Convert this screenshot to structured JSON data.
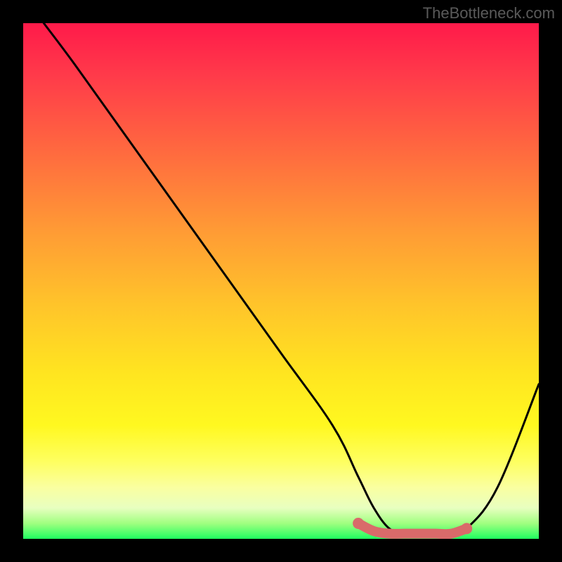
{
  "watermark": "TheBottleneck.com",
  "chart_data": {
    "type": "line",
    "title": "",
    "xlabel": "",
    "ylabel": "",
    "xlim": [
      0,
      100
    ],
    "ylim": [
      0,
      100
    ],
    "series": [
      {
        "name": "bottleneck-curve",
        "color": "#000000",
        "x": [
          4,
          10,
          20,
          30,
          40,
          50,
          60,
          65,
          68,
          71,
          74,
          77,
          80,
          83,
          86,
          92,
          100
        ],
        "y": [
          100,
          92,
          78,
          64,
          50,
          36,
          22,
          12,
          6,
          2,
          1,
          1,
          1,
          1,
          2,
          10,
          30
        ]
      },
      {
        "name": "marker-band",
        "color": "#d96a6a",
        "x": [
          65,
          68,
          71,
          74,
          77,
          80,
          83,
          86
        ],
        "y": [
          3,
          1.5,
          1,
          1,
          1,
          1,
          1,
          2
        ]
      }
    ],
    "gradient_stops": [
      {
        "pos": 0,
        "color": "#ff1a4a"
      },
      {
        "pos": 10,
        "color": "#ff3a4a"
      },
      {
        "pos": 25,
        "color": "#ff6a3f"
      },
      {
        "pos": 40,
        "color": "#ff9a35"
      },
      {
        "pos": 55,
        "color": "#ffc52a"
      },
      {
        "pos": 68,
        "color": "#ffe520"
      },
      {
        "pos": 78,
        "color": "#fff820"
      },
      {
        "pos": 85,
        "color": "#feff60"
      },
      {
        "pos": 90,
        "color": "#faffa0"
      },
      {
        "pos": 94,
        "color": "#e8ffc0"
      },
      {
        "pos": 97,
        "color": "#a0ff80"
      },
      {
        "pos": 100,
        "color": "#20ff60"
      }
    ]
  }
}
